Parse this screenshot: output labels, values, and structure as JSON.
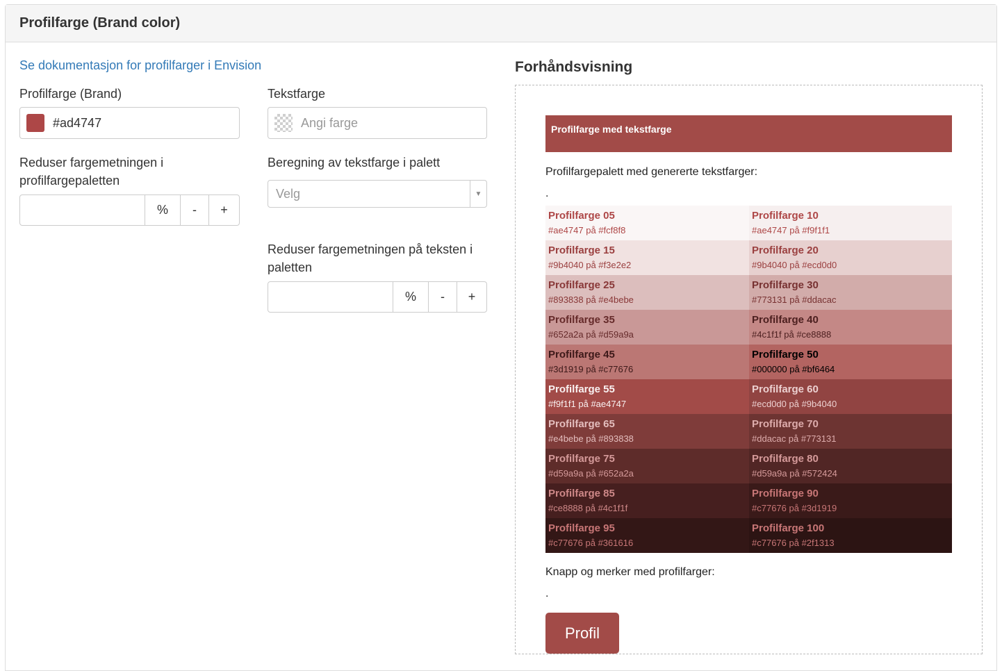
{
  "panel": {
    "title": "Profilfarge (Brand color)"
  },
  "form": {
    "doc_link": "Se dokumentasjon for profilfarger i Envision",
    "brand": {
      "label": "Profilfarge (Brand)",
      "value": "#ad4747",
      "swatch_color": "#ad4747"
    },
    "text_color": {
      "label": "Tekstfarge",
      "placeholder": "Angi farge"
    },
    "reduce_palette": {
      "label_line1": "Reduser fargemetningen i",
      "label_line2": "profilfargepaletten",
      "value": "",
      "unit": "%",
      "minus": "-",
      "plus": "+"
    },
    "calc": {
      "label": "Beregning av tekstfarge i palett",
      "placeholder": "Velg"
    },
    "reduce_text": {
      "label_line1": "Reduser fargemetningen på teksten i",
      "label_line2": "paletten",
      "value": "",
      "unit": "%",
      "minus": "-",
      "plus": "+"
    }
  },
  "preview": {
    "title": "Forhåndsvisning",
    "brand_bar_text": "Profilfarge med tekstfarge",
    "brand_bar_color": "#a24b48",
    "palette_label": "Profilfargepalett med genererte tekstfarger:",
    "dot1": ".",
    "palette": [
      {
        "name": "Profilfarge 05",
        "code": "#ae4747 på #fcf8f8",
        "bg": "#faf6f6",
        "fg": "#ae4747"
      },
      {
        "name": "Profilfarge 10",
        "code": "#ae4747 på #f9f1f1",
        "bg": "#f6efef",
        "fg": "#ae4747"
      },
      {
        "name": "Profilfarge 15",
        "code": "#9b4040 på #f3e2e2",
        "bg": "#f1e2e1",
        "fg": "#9b4040"
      },
      {
        "name": "Profilfarge 20",
        "code": "#9b4040 på #ecd0d0",
        "bg": "#e7d0cf",
        "fg": "#9b4040"
      },
      {
        "name": "Profilfarge 25",
        "code": "#893838 på #e4bebe",
        "bg": "#dcbebd",
        "fg": "#893838"
      },
      {
        "name": "Profilfarge 30",
        "code": "#773131 på #ddacac",
        "bg": "#d2acaa",
        "fg": "#773131"
      },
      {
        "name": "Profilfarge 35",
        "code": "#652a2a på #d59a9a",
        "bg": "#c99897",
        "fg": "#652a2a"
      },
      {
        "name": "Profilfarge 40",
        "code": "#4c1f1f på #ce8888",
        "bg": "#c48886",
        "fg": "#4c1f1f"
      },
      {
        "name": "Profilfarge 45",
        "code": "#3d1919 på #c77676",
        "bg": "#bb7774",
        "fg": "#3d1919"
      },
      {
        "name": "Profilfarge 50",
        "code": "#000000 på #bf6464",
        "bg": "#b36461",
        "fg": "#000000"
      },
      {
        "name": "Profilfarge 55",
        "code": "#f9f1f1 på #ae4747",
        "bg": "#a24b48",
        "fg": "#f9f1f1"
      },
      {
        "name": "Profilfarge 60",
        "code": "#ecd0d0 på #9b4040",
        "bg": "#914442",
        "fg": "#ecd0d0"
      },
      {
        "name": "Profilfarge 65",
        "code": "#e4bebe på #893838",
        "bg": "#7f3c3a",
        "fg": "#e4bebe"
      },
      {
        "name": "Profilfarge 70",
        "code": "#ddacac på #773131",
        "bg": "#6d3432",
        "fg": "#ddacac"
      },
      {
        "name": "Profilfarge 75",
        "code": "#d59a9a på #652a2a",
        "bg": "#5e2c2a",
        "fg": "#d59a9a"
      },
      {
        "name": "Profilfarge 80",
        "code": "#d59a9a på #572424",
        "bg": "#512625",
        "fg": "#d59a9a"
      },
      {
        "name": "Profilfarge 85",
        "code": "#ce8888 på #4c1f1f",
        "bg": "#461f1f",
        "fg": "#ce8888"
      },
      {
        "name": "Profilfarge 90",
        "code": "#c77676 på #3d1919",
        "bg": "#3a1a19",
        "fg": "#c77676"
      },
      {
        "name": "Profilfarge 95",
        "code": "#c77676 på #361616",
        "bg": "#331716",
        "fg": "#c77676"
      },
      {
        "name": "Profilfarge 100",
        "code": "#c77676 på #2f1313",
        "bg": "#2c1413",
        "fg": "#c77676"
      }
    ],
    "buttons_label": "Knapp og merker med profilfarger:",
    "dot2": ".",
    "button_text": "Profil"
  }
}
